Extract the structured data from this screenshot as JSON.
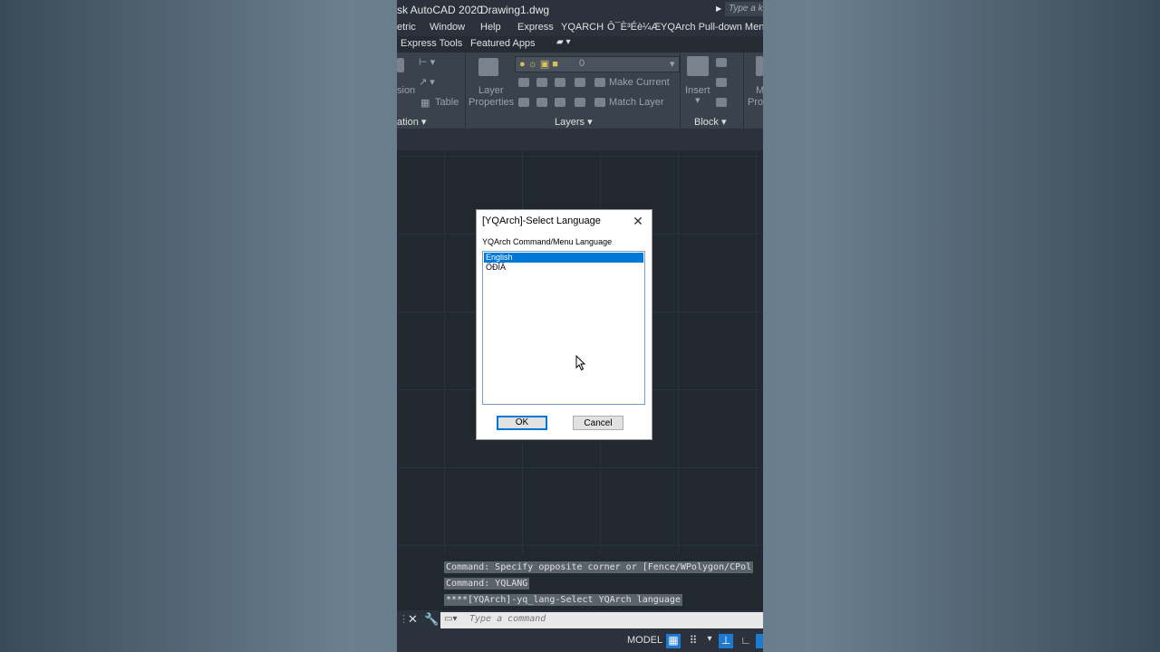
{
  "titlebar": {
    "app_title": "sk AutoCAD 2020",
    "file_name": "Drawing1.dwg",
    "search_placeholder": "Type a ke"
  },
  "menu": {
    "items": [
      "etric",
      "Window",
      "Help",
      "Express",
      "YQARCH",
      "Ô¯È³Éè¼Æ",
      "YQArch Pull-down Menu"
    ]
  },
  "tabs": {
    "items": [
      "Express Tools",
      "Featured Apps"
    ]
  },
  "ribbon": {
    "left_labels": [
      "sion",
      "Table"
    ],
    "layer_properties_line1": "Layer",
    "layer_properties_line2": "Properties",
    "layer_dropdown_value": "0",
    "make_current": "Make Current",
    "match_layer": "Match Layer",
    "insert": "Insert",
    "props_partial_1": "M",
    "props_partial_2": "Pro",
    "panel_annotation": "ation",
    "panel_layers": "Layers",
    "panel_block": "Block"
  },
  "dialog": {
    "title": "[YQArch]-Select Language",
    "label": "YQArch Command/Menu Language",
    "options": [
      {
        "text": "English",
        "selected": true
      },
      {
        "text": "ÖÐÎÄ",
        "selected": false
      }
    ],
    "ok": "OK",
    "cancel": "Cancel"
  },
  "command": {
    "history": [
      "Command: Specify opposite corner or [Fence/WPolygon/CPol",
      "Command: YQLANG",
      "****[YQArch]-yq_lang-Select YQArch language"
    ],
    "placeholder": "Type a command"
  },
  "status": {
    "model": "MODEL"
  },
  "colors": {
    "accent": "#0078d7",
    "app_bg": "#212830"
  }
}
